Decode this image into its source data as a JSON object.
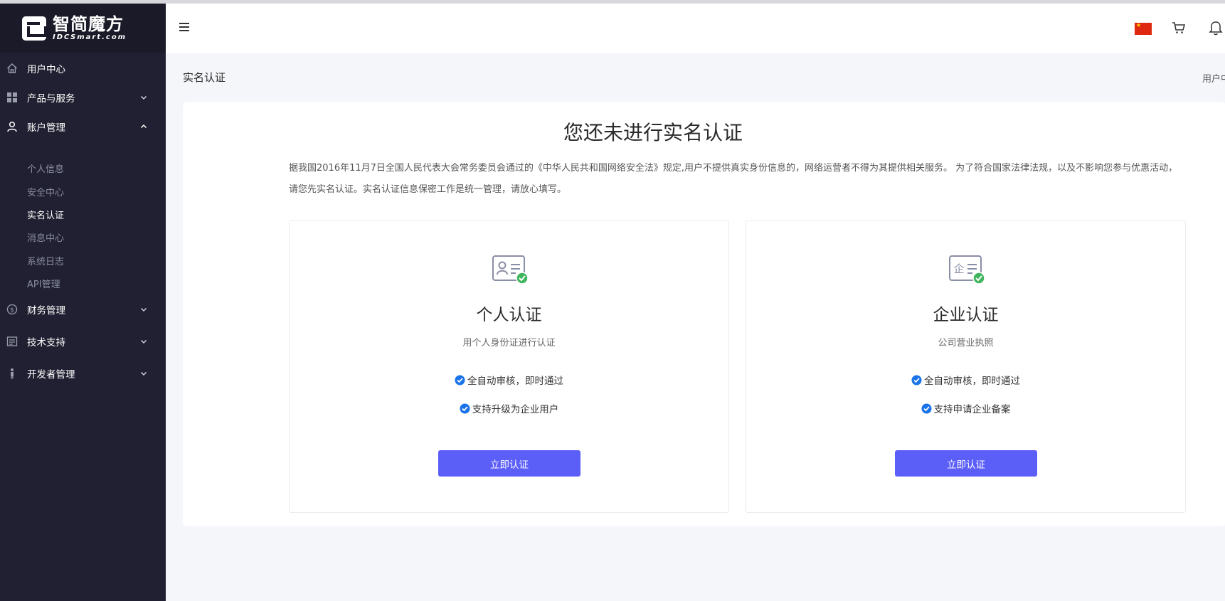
{
  "brand": {
    "name_cn": "智简魔方",
    "name_en": "IDCSmart.com"
  },
  "sidebar": {
    "items": [
      {
        "label": "用户中心",
        "icon": "home-icon"
      },
      {
        "label": "产品与服务",
        "icon": "grid-icon"
      },
      {
        "label": "账户管理",
        "icon": "user-icon",
        "expanded": true
      },
      {
        "label": "财务管理",
        "icon": "dollar-icon"
      },
      {
        "label": "技术支持",
        "icon": "document-icon"
      },
      {
        "label": "开发者管理",
        "icon": "developer-icon"
      }
    ],
    "subitems": [
      "个人信息",
      "安全中心",
      "实名认证",
      "消息中心",
      "系统日志",
      "API管理"
    ],
    "active_subitem": "实名认证"
  },
  "header": {
    "language_flag": "china-flag-icon"
  },
  "page": {
    "title": "实名认证",
    "breadcrumb": "用户中",
    "heading": "您还未进行实名认证",
    "notice": "据我国2016年11月7日全国人民代表大会常务委员会通过的《中华人民共和国网络安全法》规定,用户不提供真实身份信息的，网络运营者不得为其提供相关服务。 为了符合国家法律法规，以及不影响您参与优惠活动，请您先实名认证。实名认证信息保密工作是统一管理，请放心填写。"
  },
  "options": [
    {
      "title": "个人认证",
      "subtitle": "用个人身份证进行认证",
      "features": [
        "全自动审核，即时通过",
        "支持升级为企业用户"
      ],
      "button": "立即认证"
    },
    {
      "title": "企业认证",
      "subtitle": "公司营业执照",
      "features": [
        "全自动审核，即时通过",
        "支持申请企业备案"
      ],
      "button": "立即认证"
    }
  ],
  "colors": {
    "sidebar_bg": "#202032",
    "primary": "#5b5ef7",
    "check": "#1a73e8",
    "verified": "#3fb55e"
  }
}
